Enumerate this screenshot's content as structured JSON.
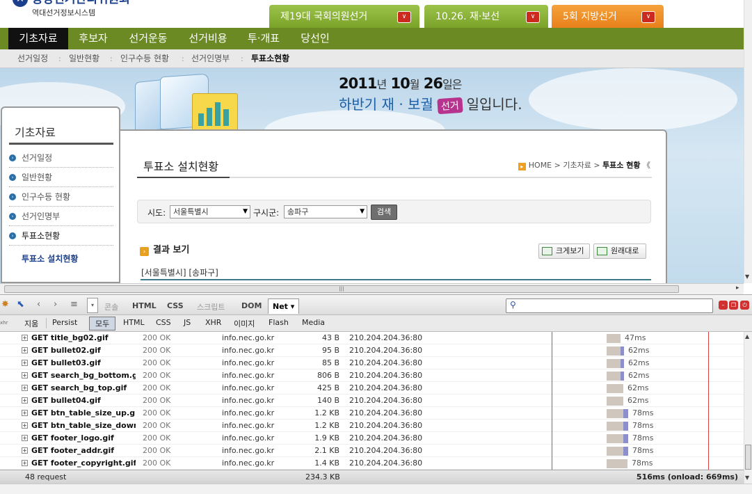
{
  "site": {
    "logo_name": "중앙선거관리위원회",
    "logo_sub": "역대선거정보시스템"
  },
  "election_tabs": [
    {
      "label": "제19대 국회의원선거"
    },
    {
      "label": "10.26. 재·보선"
    },
    {
      "label": "5회 지방선거"
    }
  ],
  "main_nav": [
    {
      "label": "기초자료",
      "active": true
    },
    {
      "label": "후보자"
    },
    {
      "label": "선거운동"
    },
    {
      "label": "선거비용"
    },
    {
      "label": "투·개표"
    },
    {
      "label": "당선인"
    }
  ],
  "sub_nav": [
    {
      "label": "선거일정"
    },
    {
      "label": "일반현황"
    },
    {
      "label": "인구수등 현황"
    },
    {
      "label": "선거인명부"
    },
    {
      "label": "투표소현황",
      "active": true
    }
  ],
  "sub_nav_sep": ":",
  "banner": {
    "year": "2011",
    "year_unit": "년",
    "month": "10",
    "month_unit": "월",
    "day": "26",
    "day_unit": "일은",
    "line2_a": "하반기 재 · 보궐",
    "badge": "선거",
    "line2_b": "일입니다."
  },
  "left_menu": {
    "title": "기초자료",
    "items": [
      {
        "label": "선거일정"
      },
      {
        "label": "일반현황"
      },
      {
        "label": "인구수등 현황"
      },
      {
        "label": "선거인명부"
      },
      {
        "label": "투표소현황",
        "active": true
      }
    ],
    "sub_item": "투표소 설치현황"
  },
  "content": {
    "title": "투표소 설치현황",
    "breadcrumb": {
      "home": "HOME",
      "sep": ">",
      "mid": "기초자료",
      "current": "투표소 현황",
      "more": "《"
    },
    "search": {
      "sido_label": "시도:",
      "sido_value": "서울특별시",
      "gu_label": "구시군:",
      "gu_value": "송파구",
      "button": "검색"
    },
    "result_label": "결과 보기",
    "zoom_in": "크게보기",
    "zoom_reset": "원래대로",
    "region": "[서울특별시] [송파구]"
  },
  "firebug": {
    "tabs": [
      {
        "label": "콘솔",
        "dim": true
      },
      {
        "label": "HTML"
      },
      {
        "label": "CSS"
      },
      {
        "label": "스크립트",
        "dim": true
      },
      {
        "label": "DOM"
      },
      {
        "label": "Net ▾",
        "active": true
      }
    ],
    "filters": [
      {
        "label": "지움"
      },
      {
        "label": "Persist"
      },
      {
        "label": "모두",
        "active": true
      },
      {
        "label": "HTML"
      },
      {
        "label": "CSS"
      },
      {
        "label": "JS"
      },
      {
        "label": "XHR"
      },
      {
        "label": "이미지"
      },
      {
        "label": "Flash"
      },
      {
        "label": "Media"
      }
    ],
    "xhr_mini": "xhr",
    "requests": [
      {
        "url": "GET title_bg02.gif",
        "status": "200 OK",
        "domain": "info.nec.go.kr",
        "size": "43 B",
        "ip": "210.204.204.36:80",
        "time": "47ms",
        "wait": 0.66,
        "recv": 0.0
      },
      {
        "url": "GET bullet02.gif",
        "status": "200 OK",
        "domain": "info.nec.go.kr",
        "size": "95 B",
        "ip": "210.204.204.36:80",
        "time": "62ms",
        "wait": 0.66,
        "recv": 0.15
      },
      {
        "url": "GET bullet03.gif",
        "status": "200 OK",
        "domain": "info.nec.go.kr",
        "size": "85 B",
        "ip": "210.204.204.36:80",
        "time": "62ms",
        "wait": 0.66,
        "recv": 0.15
      },
      {
        "url": "GET search_bg_bottom.gi",
        "status": "200 OK",
        "domain": "info.nec.go.kr",
        "size": "806 B",
        "ip": "210.204.204.36:80",
        "time": "62ms",
        "wait": 0.66,
        "recv": 0.15
      },
      {
        "url": "GET search_bg_top.gif",
        "status": "200 OK",
        "domain": "info.nec.go.kr",
        "size": "425 B",
        "ip": "210.204.204.36:80",
        "time": "62ms",
        "wait": 0.8,
        "recv": 0.0
      },
      {
        "url": "GET bullet04.gif",
        "status": "200 OK",
        "domain": "info.nec.go.kr",
        "size": "140 B",
        "ip": "210.204.204.36:80",
        "time": "62ms",
        "wait": 0.8,
        "recv": 0.0
      },
      {
        "url": "GET btn_table_size_up.gi",
        "status": "200 OK",
        "domain": "info.nec.go.kr",
        "size": "1.2 KB",
        "ip": "210.204.204.36:80",
        "time": "78ms",
        "wait": 0.8,
        "recv": 0.24
      },
      {
        "url": "GET btn_table_size_down",
        "status": "200 OK",
        "domain": "info.nec.go.kr",
        "size": "1.2 KB",
        "ip": "210.204.204.36:80",
        "time": "78ms",
        "wait": 0.8,
        "recv": 0.24
      },
      {
        "url": "GET footer_logo.gif",
        "status": "200 OK",
        "domain": "info.nec.go.kr",
        "size": "1.9 KB",
        "ip": "210.204.204.36:80",
        "time": "78ms",
        "wait": 0.8,
        "recv": 0.24
      },
      {
        "url": "GET footer_addr.gif",
        "status": "200 OK",
        "domain": "info.nec.go.kr",
        "size": "2.1 KB",
        "ip": "210.204.204.36:80",
        "time": "78ms",
        "wait": 0.8,
        "recv": 0.24
      },
      {
        "url": "GET footer_copyright.gif",
        "status": "200 OK",
        "domain": "info.nec.go.kr",
        "size": "1.4 KB",
        "ip": "210.204.204.36:80",
        "time": "78ms",
        "wait": 1.0,
        "recv": 0.0
      }
    ],
    "summary": {
      "count": "48 request",
      "total_size": "234.3 KB",
      "total_time": "516ms (onload: 669ms)"
    },
    "colors": {
      "wait_bar": "#cfc6bd",
      "recv_bar": "#8c8fc9",
      "domcontent_line": "#5a6fc0",
      "onload_line": "#d04040"
    }
  }
}
